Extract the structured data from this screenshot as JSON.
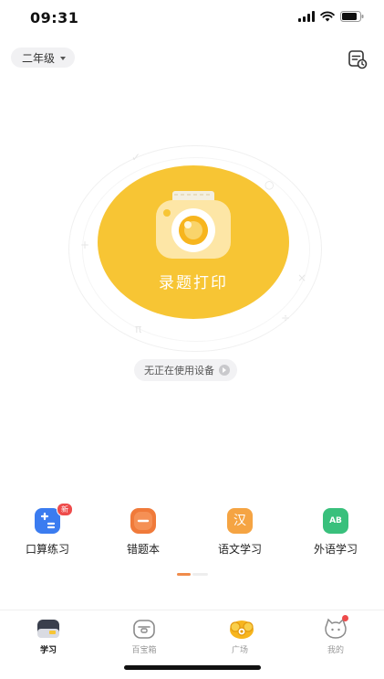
{
  "status_bar": {
    "time": "09:31"
  },
  "header": {
    "grade": "二年级",
    "history_icon": "notes-history-icon"
  },
  "hero": {
    "action_label": "录题打印",
    "decor_marks": [
      "✓",
      "○",
      "+",
      "×",
      "π",
      "÷"
    ]
  },
  "device_status": "无正在使用设备",
  "features": [
    {
      "label": "口算练习",
      "icon": "calculator-icon",
      "color": "#3b7cf0",
      "badge": "新"
    },
    {
      "label": "错题本",
      "icon": "mistake-book-icon",
      "color": "#f07a3a"
    },
    {
      "label": "语文学习",
      "icon": "chinese-character-icon",
      "color": "#f5a443",
      "glyph": "汉"
    },
    {
      "label": "外语学习",
      "icon": "foreign-language-icon",
      "color": "#39c07c",
      "glyph": "AB"
    }
  ],
  "tabs": [
    {
      "label": "学习",
      "icon": "study-icon",
      "active": true
    },
    {
      "label": "百宝箱",
      "icon": "toolbox-icon",
      "active": false
    },
    {
      "label": "广场",
      "icon": "plaza-icon",
      "active": false
    },
    {
      "label": "我的",
      "icon": "profile-cat-icon",
      "active": false,
      "dot": true
    }
  ]
}
